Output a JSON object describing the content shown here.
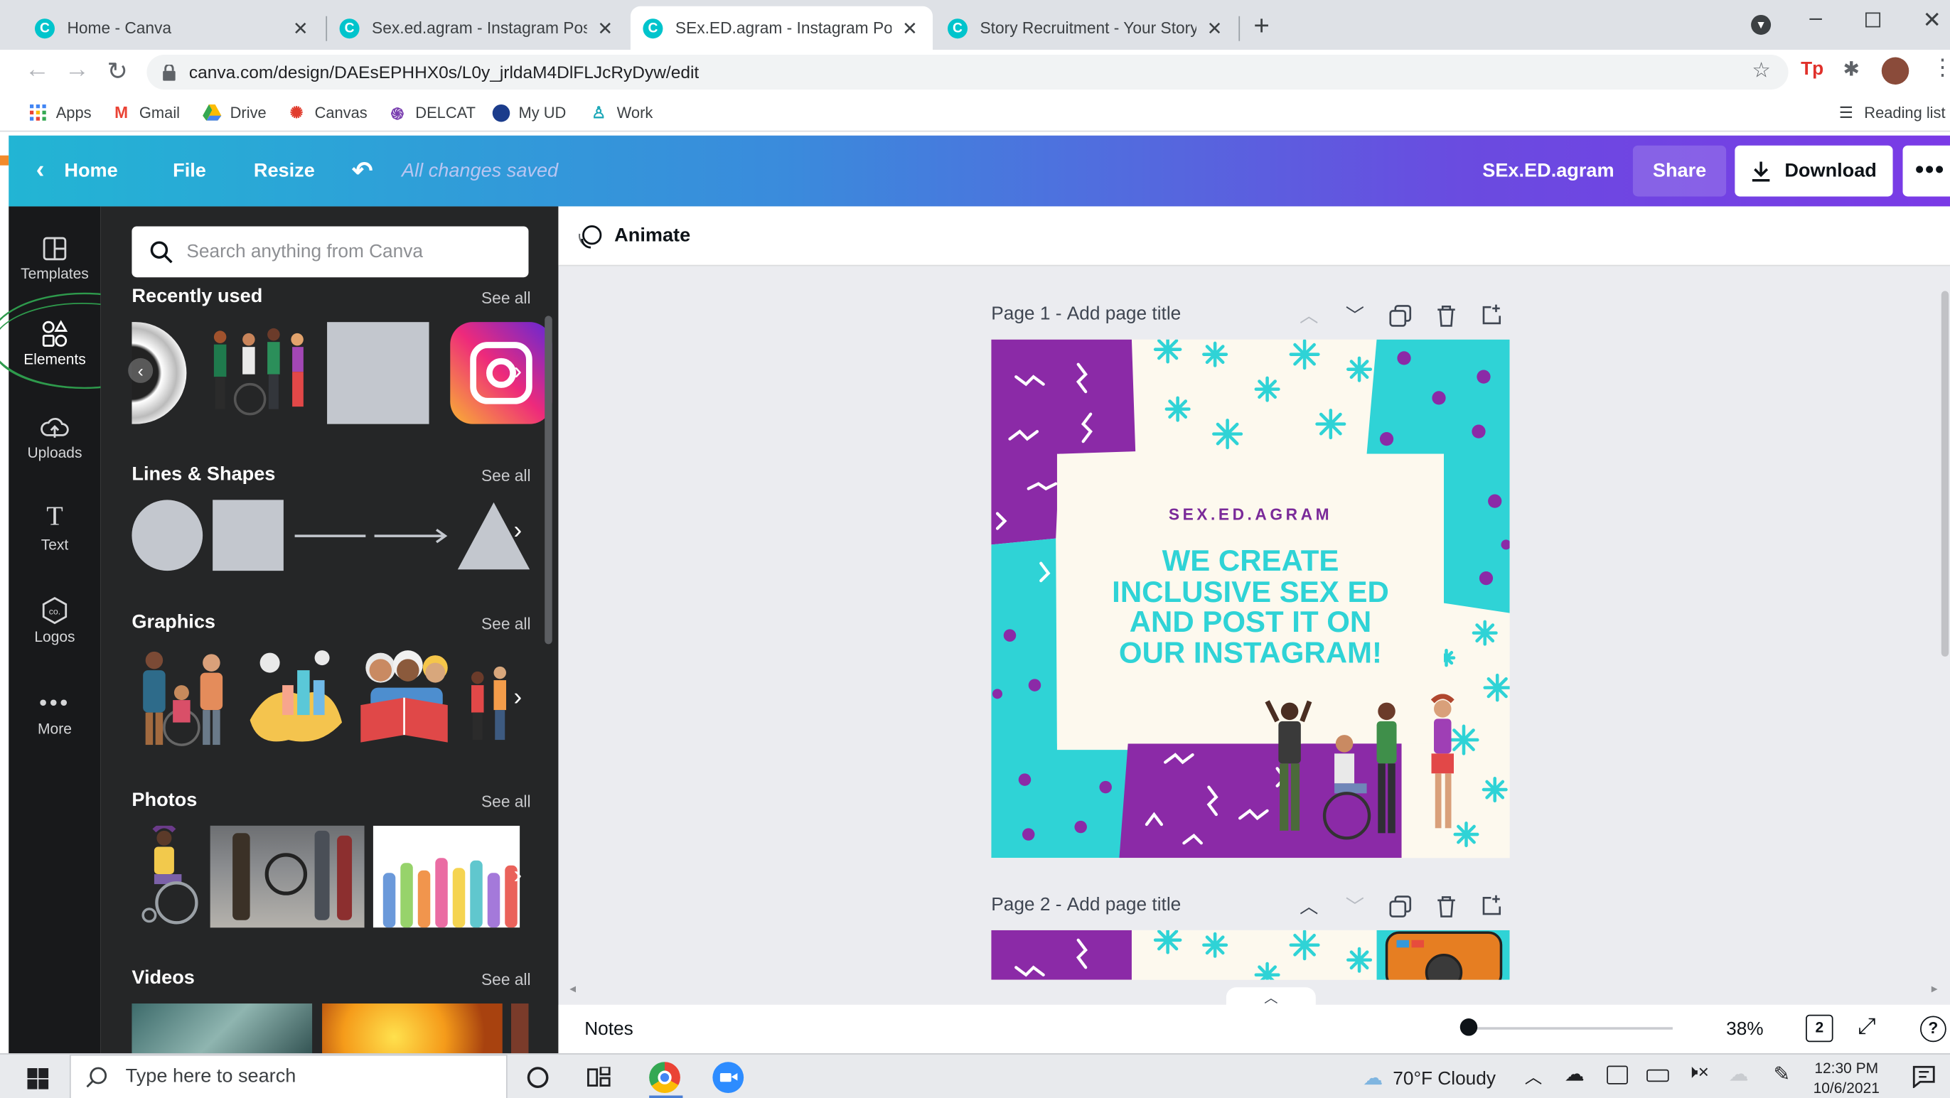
{
  "browser": {
    "tabs": [
      {
        "title": "Home - Canva"
      },
      {
        "title": "Sex.ed.agram - Instagram Post"
      },
      {
        "title": "SEx.ED.agram - Instagram Post"
      },
      {
        "title": "Story Recruitment - Your Story"
      }
    ],
    "url": "canva.com/design/DAEsEPHHX0s/L0y_jrldaM4DlFLJcRyDyw/edit",
    "bookmarks": [
      "Apps",
      "Gmail",
      "Drive",
      "Canvas",
      "DELCAT",
      "My UD",
      "Work"
    ],
    "reading_list": "Reading list"
  },
  "canva": {
    "header": {
      "home": "Home",
      "file": "File",
      "resize": "Resize",
      "saved": "All changes saved",
      "design_name": "SEx.ED.agram",
      "share": "Share",
      "download": "Download"
    },
    "sidebar": [
      "Templates",
      "Elements",
      "Uploads",
      "Text",
      "Logos",
      "More"
    ],
    "panel": {
      "search_placeholder": "Search anything from Canva",
      "see_all": "See all",
      "sections": [
        "Recently used",
        "Lines & Shapes",
        "Graphics",
        "Photos",
        "Videos"
      ]
    },
    "toolbar": {
      "animate": "Animate"
    },
    "pages": [
      {
        "label": "Page 1",
        "title_placeholder": "Add page title"
      },
      {
        "label": "Page 2",
        "title_placeholder": "Add page title"
      }
    ],
    "poster": {
      "handle": "SEX.ED.AGRAM",
      "headline": [
        "WE CREATE",
        "INCLUSIVE SEX ED",
        "AND POST IT ON",
        "OUR INSTAGRAM!"
      ]
    },
    "footer": {
      "notes": "Notes",
      "zoom": "38%",
      "page_count": "2"
    },
    "colors": {
      "purple": "#8b2aa7",
      "teal": "#2fd3d6",
      "cream": "#fdf9ee",
      "teal_text": "#2fd3d6",
      "handle_text": "#7a2a99"
    }
  },
  "taskbar": {
    "search_placeholder": "Type here to search",
    "weather": "70°F  Cloudy",
    "time": "12:30 PM",
    "date": "10/6/2021"
  }
}
